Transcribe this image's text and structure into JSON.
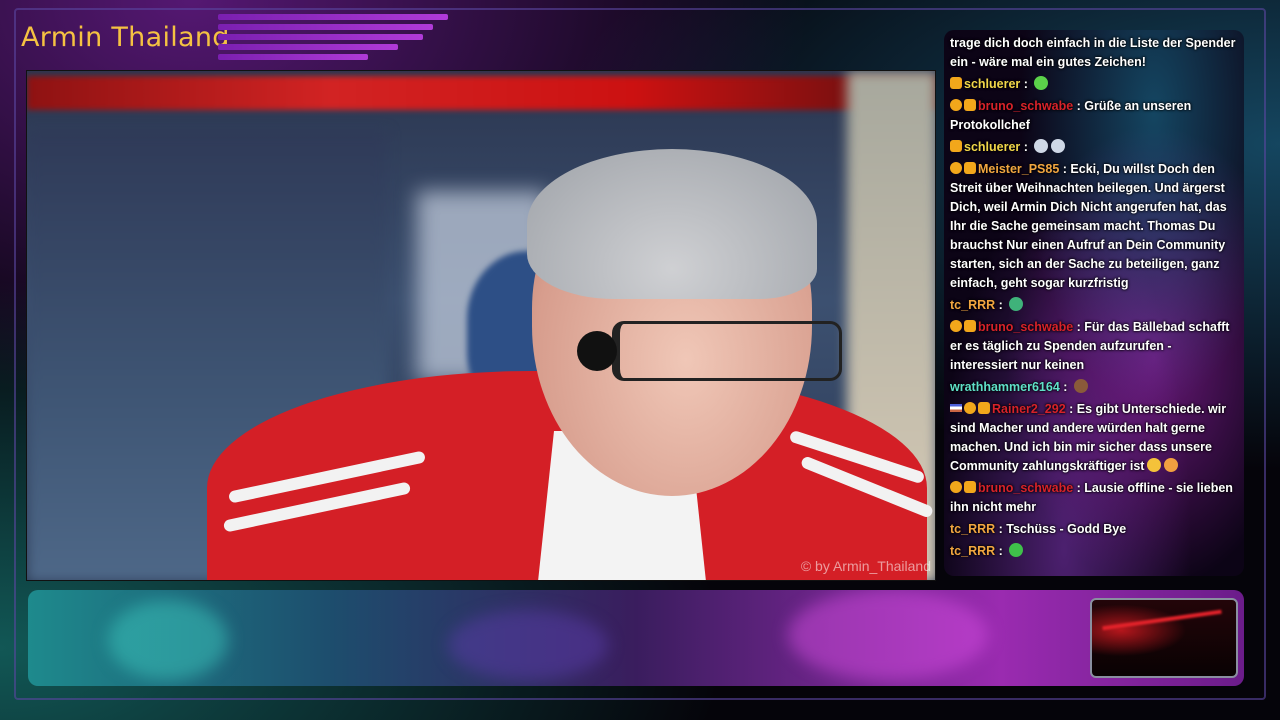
{
  "header": {
    "channel_title": "Armin Thailand"
  },
  "video": {
    "watermark": "© by Armin_Thailand"
  },
  "chat": {
    "messages": [
      {
        "user": "",
        "user_color": "#ffffff",
        "badges": [],
        "text": "trage dich doch einfach in die Liste der Spender ein - wäre mal ein gutes Zeichen!",
        "emotes": []
      },
      {
        "user": "schluerer",
        "user_color": "#f1d64a",
        "badges": [
          "crown"
        ],
        "text": "",
        "emotes": [
          "green-smile-emote"
        ]
      },
      {
        "user": "bruno_schwabe",
        "user_color": "#d7222a",
        "badges": [
          "alert",
          "crown"
        ],
        "text": "Grüße an unseren Protokollchef",
        "emotes": []
      },
      {
        "user": "schluerer",
        "user_color": "#f1d64a",
        "badges": [
          "crown"
        ],
        "text": "",
        "emotes": [
          "hand-emote",
          "hand-emote"
        ]
      },
      {
        "user": "Meister_PS85",
        "user_color": "#f1a640",
        "badges": [
          "alert",
          "crown"
        ],
        "text": "Ecki, Du willst Doch den Streit über Weihnachten beilegen. Und ärgerst Dich, weil Armin Dich Nicht angerufen hat, das Ihr die Sache gemeinsam macht. Thomas Du brauchst Nur einen Aufruf an Dein Community starten, sich an der Sache zu beteiligen, ganz einfach, geht sogar kurzfristig",
        "emotes": []
      },
      {
        "user": "tc_RRR",
        "user_color": "#f1a640",
        "badges": [],
        "text": "",
        "emotes": [
          "globe-emote"
        ]
      },
      {
        "user": "bruno_schwabe",
        "user_color": "#d7222a",
        "badges": [
          "alert",
          "crown"
        ],
        "text": "Für das Bällebad schafft er es täglich zu Spenden aufzurufen - interessiert nur keinen",
        "emotes": []
      },
      {
        "user": "wrathhammer6164",
        "user_color": "#5fe0c8",
        "badges": [],
        "text": "",
        "emotes": [
          "face-emote"
        ]
      },
      {
        "user": "Rainer2_292",
        "user_color": "#d7222a",
        "badges": [
          "flag",
          "alert",
          "crown"
        ],
        "text": "Es gibt Unterschiede. wir sind Macher und andere würden halt gerne machen. Und ich bin mir sicher dass unsere Community zahlungskräftiger ist",
        "emotes": [
          "smile-emote",
          "laugh-emote"
        ]
      },
      {
        "user": "bruno_schwabe",
        "user_color": "#d7222a",
        "badges": [
          "alert",
          "crown"
        ],
        "text": "Lausie offline - sie lieben ihn nicht mehr",
        "emotes": []
      },
      {
        "user": "tc_RRR",
        "user_color": "#f1a640",
        "badges": [],
        "text": "Tschüss - Godd Bye",
        "emotes": []
      },
      {
        "user": "tc_RRR",
        "user_color": "#f1a640",
        "badges": [],
        "text": "",
        "emotes": [
          "green-wave-emote"
        ]
      }
    ]
  },
  "colors": {
    "title": "#f5c242",
    "accent": "#b03ad8"
  }
}
